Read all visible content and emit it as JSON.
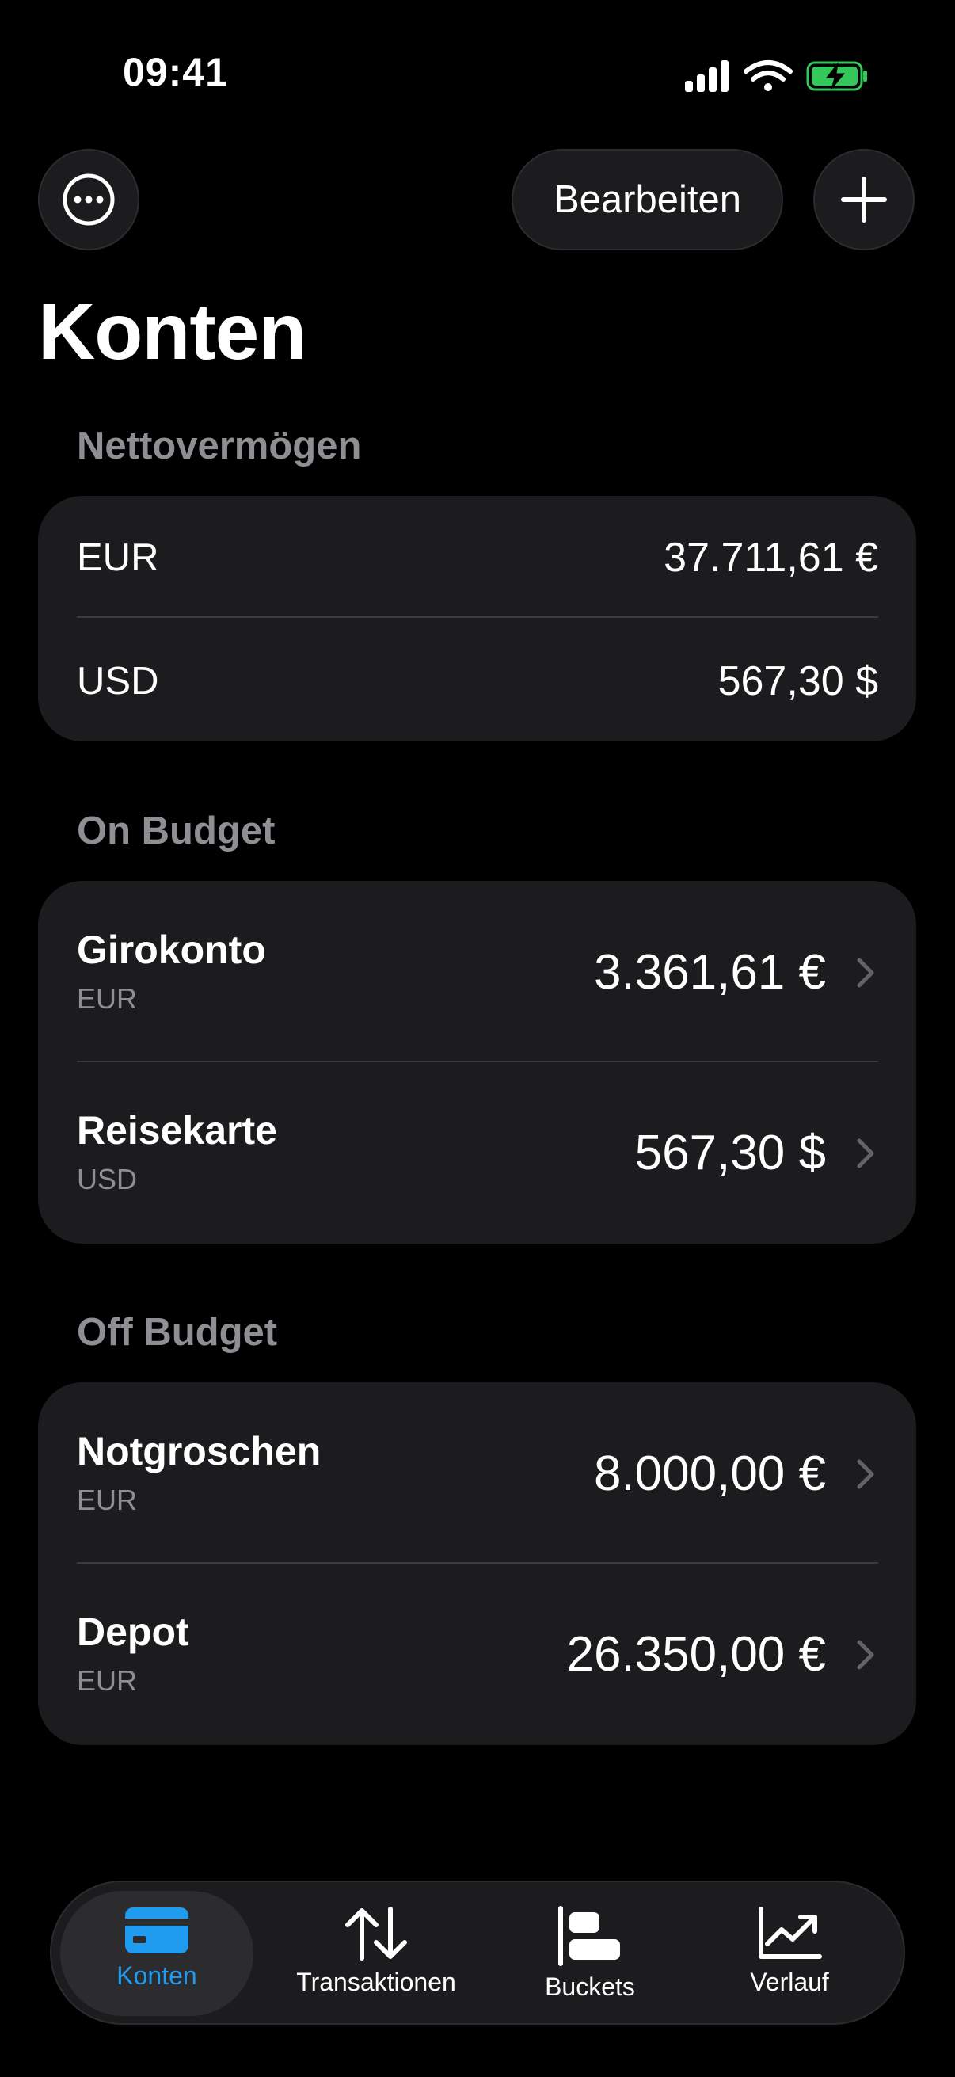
{
  "status_bar": {
    "time": "09:41",
    "icons": [
      "cellular-signal-icon",
      "wifi-icon",
      "battery-charging-icon"
    ],
    "battery_color": "#34c759"
  },
  "toolbar": {
    "more_icon": "ellipsis-circle-icon",
    "edit_label": "Bearbeiten",
    "add_icon": "plus-icon"
  },
  "page_title": "Konten",
  "net_worth": {
    "header": "Nettovermögen",
    "rows": [
      {
        "currency": "EUR",
        "amount": "37.711,61 €"
      },
      {
        "currency": "USD",
        "amount": "567,30 $"
      }
    ]
  },
  "on_budget": {
    "header": "On Budget",
    "accounts": [
      {
        "name": "Girokonto",
        "currency": "EUR",
        "amount": "3.361,61 €"
      },
      {
        "name": "Reisekarte",
        "currency": "USD",
        "amount": "567,30 $"
      }
    ]
  },
  "off_budget": {
    "header": "Off Budget",
    "accounts": [
      {
        "name": "Notgroschen",
        "currency": "EUR",
        "amount": "8.000,00 €"
      },
      {
        "name": "Depot",
        "currency": "EUR",
        "amount": "26.350,00 €"
      }
    ]
  },
  "tabbar": {
    "accent_color": "#1f9bf0",
    "tabs": [
      {
        "label": "Konten",
        "icon": "credit-card-icon",
        "active": true
      },
      {
        "label": "Transaktionen",
        "icon": "arrows-up-down-icon",
        "active": false
      },
      {
        "label": "Buckets",
        "icon": "bars-align-left-icon",
        "active": false
      },
      {
        "label": "Verlauf",
        "icon": "trend-chart-icon",
        "active": false
      }
    ]
  }
}
